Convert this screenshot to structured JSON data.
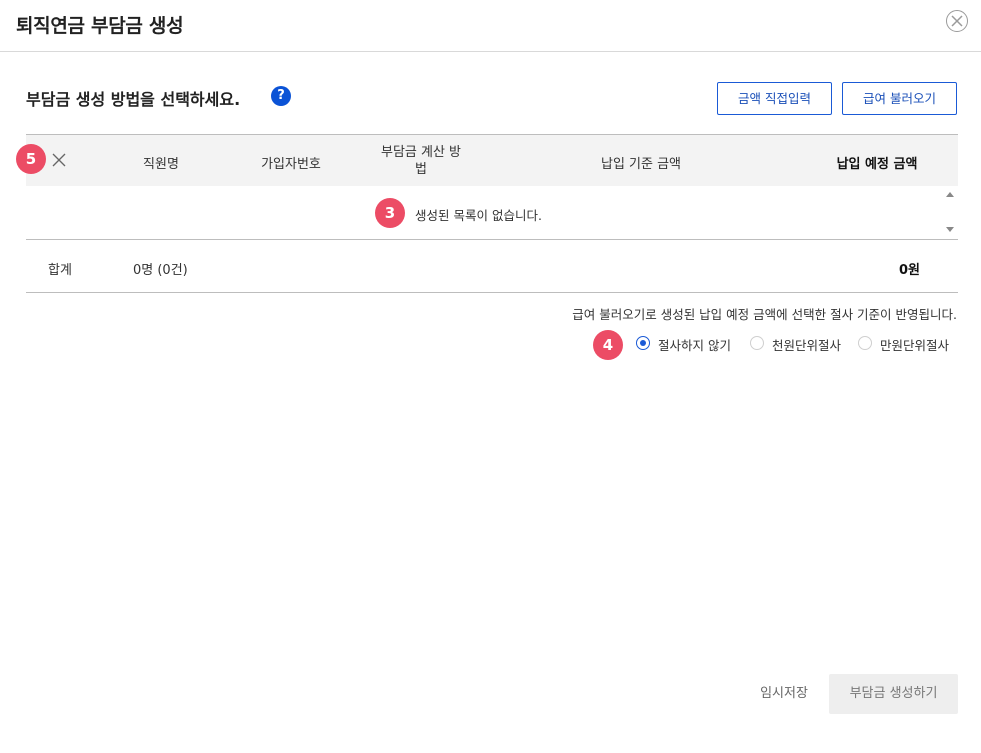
{
  "header": {
    "title": "퇴직연금 부담금 생성",
    "close_icon": "close-circle-icon"
  },
  "toolbar": {
    "subtitle": "부담금 생성 방법을 선택하세요.",
    "help_label": "?",
    "direct_input_label": "금액 직접입력",
    "load_salary_label": "급여 불러오기",
    "accent_color": "#1a5ad6"
  },
  "table": {
    "columns": {
      "employee_name": "직원명",
      "member_no": "가입자번호",
      "calc_method_line1": "부담금 계산 방",
      "calc_method_line2": "법",
      "base_amount": "납입 기준 금액",
      "expected_amount": "납입 예정 금액"
    },
    "empty_message": "생성된 목록이 없습니다.",
    "total": {
      "label": "합계",
      "count": "0명 (0건)",
      "amount": "0원"
    }
  },
  "rounding": {
    "notice": "급여 불러오기로 생성된 납입 예정 금액에 선택한 절사 기준이 반영됩니다.",
    "options": [
      {
        "label": "절사하지 않기",
        "selected": true
      },
      {
        "label": "천원단위절사",
        "selected": false
      },
      {
        "label": "만원단위절사",
        "selected": false
      }
    ]
  },
  "badges": {
    "five": "5",
    "three": "3",
    "four": "4",
    "color": "#ec4c65"
  },
  "footer": {
    "temp_save_label": "임시저장",
    "create_label": "부담금 생성하기"
  }
}
